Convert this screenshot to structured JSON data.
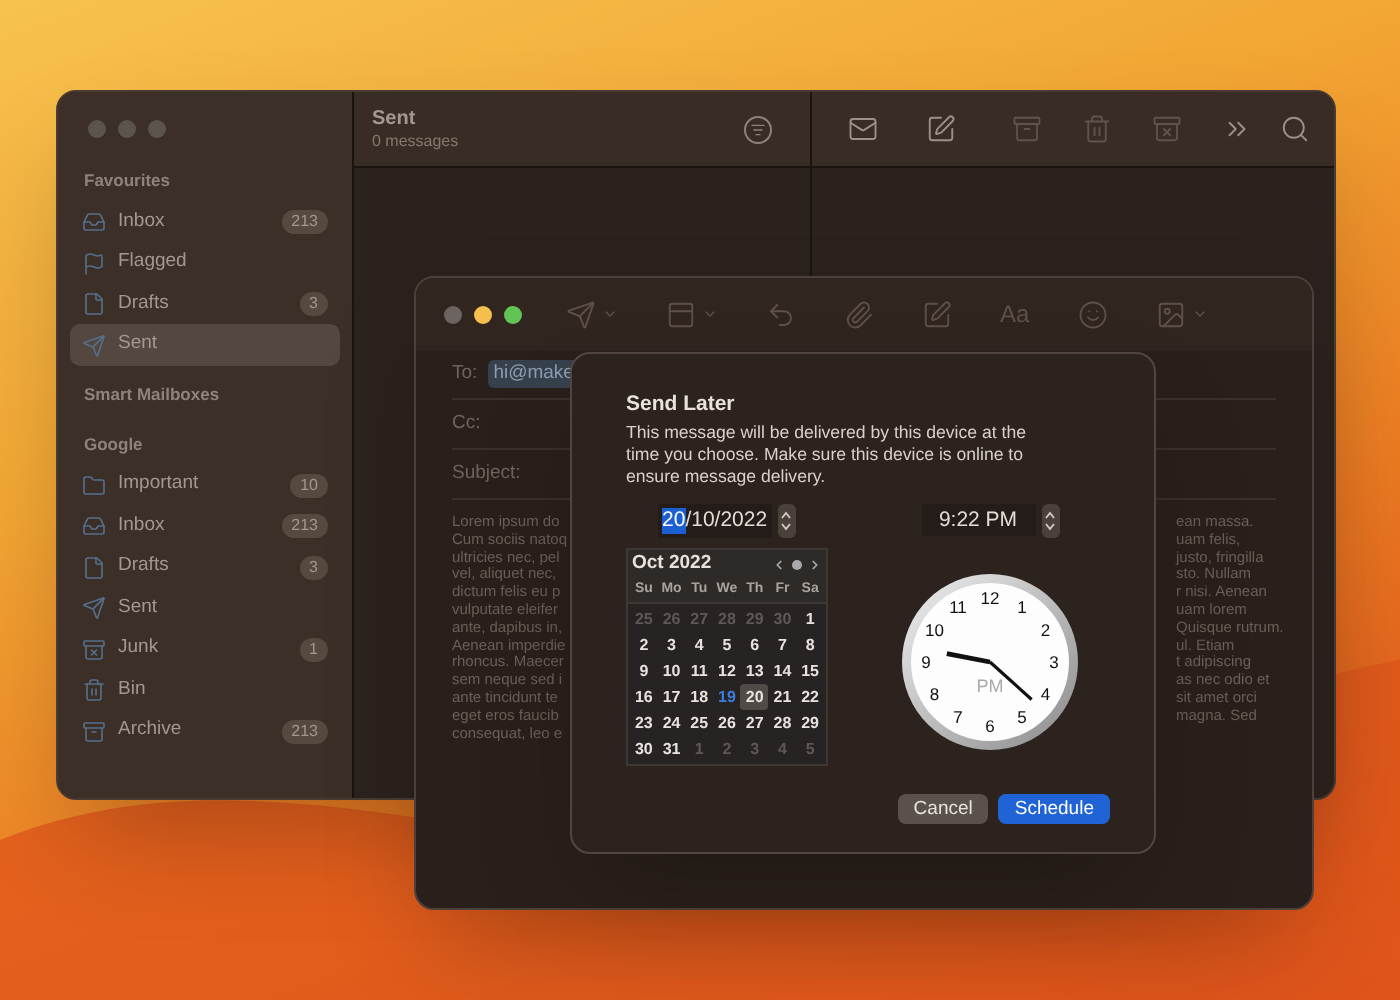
{
  "mail_window": {
    "sidebar": {
      "sections": [
        {
          "title": "Favourites",
          "items": [
            {
              "kind": "inbox",
              "label": "Inbox",
              "count": "213",
              "selected": false
            },
            {
              "kind": "flag",
              "label": "Flagged",
              "selected": false
            },
            {
              "kind": "drafts",
              "label": "Drafts",
              "count": "3",
              "selected": false
            },
            {
              "kind": "sent",
              "label": "Sent",
              "selected": true
            }
          ]
        },
        {
          "title": "Smart Mailboxes"
        },
        {
          "title": "Google",
          "items": [
            {
              "kind": "folder",
              "label": "Important",
              "count": "10",
              "selected": false
            },
            {
              "kind": "inbox",
              "label": "Inbox",
              "count": "213",
              "selected": false
            },
            {
              "kind": "drafts",
              "label": "Drafts",
              "count": "3",
              "selected": false
            },
            {
              "kind": "sent",
              "label": "Sent",
              "selected": false
            },
            {
              "kind": "junk",
              "label": "Junk",
              "count": "1",
              "selected": false
            },
            {
              "kind": "bin",
              "label": "Bin",
              "selected": false
            },
            {
              "kind": "archive",
              "label": "Archive",
              "count": "213",
              "selected": false
            }
          ]
        }
      ]
    },
    "message_list": {
      "title": "Sent",
      "subtitle": "0 messages"
    },
    "toolbar": [
      {
        "kind": "get-mail",
        "disabled": false
      },
      {
        "kind": "compose",
        "disabled": false
      },
      {
        "kind": "archive",
        "disabled": true
      },
      {
        "kind": "trash",
        "disabled": true
      },
      {
        "kind": "junk",
        "disabled": true
      },
      {
        "kind": "more",
        "disabled": false
      },
      {
        "kind": "search",
        "disabled": false
      }
    ]
  },
  "compose_window": {
    "toolbar": [
      {
        "kind": "send",
        "menu": true
      },
      {
        "kind": "header-fields",
        "menu": true
      },
      {
        "kind": "reply",
        "menu": false
      },
      {
        "kind": "attach",
        "menu": false
      },
      {
        "kind": "markup",
        "menu": false
      },
      {
        "kind": "format",
        "label": "Aa",
        "menu": false
      },
      {
        "kind": "emoji",
        "menu": false
      },
      {
        "kind": "photo",
        "menu": true
      }
    ],
    "fields": [
      {
        "label": "To:",
        "chip": "hi@make"
      },
      {
        "label": "Cc:"
      },
      {
        "label": "Subject:"
      }
    ],
    "body_left": [
      "Lorem ipsum do",
      "Cum sociis natoq",
      "ultricies nec, pel",
      "vel, aliquet nec,",
      "dictum felis eu p",
      "vulputate eleifer",
      "ante, dapibus in,",
      "Aenean imperdie",
      "rhoncus. Maecer",
      "sem neque sed i",
      "ante tincidunt te",
      "eget eros faucib",
      "consequat, leo e"
    ],
    "body_right": [
      "ean massa.",
      "uam felis,",
      "justo, fringilla",
      "sto. Nullam",
      "r nisi. Aenean",
      "uam lorem",
      "Quisque rutrum.",
      "ul. Etiam",
      "t adipiscing",
      "as nec odio et",
      "sit amet orci",
      "magna. Sed"
    ]
  },
  "send_later_dialog": {
    "title": "Send Later",
    "description": "This message will be delivered by this device at the time you choose. Make sure this device is online to ensure message delivery.",
    "date_field": [
      {
        "text": "20",
        "selected": true
      },
      {
        "text": "/10/2022",
        "selected": false
      }
    ],
    "time_field": "9:22 PM",
    "calendar": {
      "month": "Oct 2022",
      "weekdays": [
        "Su",
        "Mo",
        "Tu",
        "We",
        "Th",
        "Fr",
        "Sa"
      ],
      "weeks": [
        [
          {
            "day": "25",
            "muted": true,
            "selected": false,
            "today": false
          },
          {
            "day": "26",
            "muted": true,
            "selected": false,
            "today": false
          },
          {
            "day": "27",
            "muted": true,
            "selected": false,
            "today": false
          },
          {
            "day": "28",
            "muted": true,
            "selected": false,
            "today": false
          },
          {
            "day": "29",
            "muted": true,
            "selected": false,
            "today": false
          },
          {
            "day": "30",
            "muted": true,
            "selected": false,
            "today": false
          },
          {
            "day": "1",
            "muted": false,
            "selected": false,
            "today": false
          }
        ],
        [
          {
            "day": "2",
            "muted": false,
            "selected": false,
            "today": false
          },
          {
            "day": "3",
            "muted": false,
            "selected": false,
            "today": false
          },
          {
            "day": "4",
            "muted": false,
            "selected": false,
            "today": false
          },
          {
            "day": "5",
            "muted": false,
            "selected": false,
            "today": false
          },
          {
            "day": "6",
            "muted": false,
            "selected": false,
            "today": false
          },
          {
            "day": "7",
            "muted": false,
            "selected": false,
            "today": false
          },
          {
            "day": "8",
            "muted": false,
            "selected": false,
            "today": false
          }
        ],
        [
          {
            "day": "9",
            "muted": false,
            "selected": false,
            "today": false
          },
          {
            "day": "10",
            "muted": false,
            "selected": false,
            "today": false
          },
          {
            "day": "11",
            "muted": false,
            "selected": false,
            "today": false
          },
          {
            "day": "12",
            "muted": false,
            "selected": false,
            "today": false
          },
          {
            "day": "13",
            "muted": false,
            "selected": false,
            "today": false
          },
          {
            "day": "14",
            "muted": false,
            "selected": false,
            "today": false
          },
          {
            "day": "15",
            "muted": false,
            "selected": false,
            "today": false
          }
        ],
        [
          {
            "day": "16",
            "muted": false,
            "selected": false,
            "today": false
          },
          {
            "day": "17",
            "muted": false,
            "selected": false,
            "today": false
          },
          {
            "day": "18",
            "muted": false,
            "selected": false,
            "today": false
          },
          {
            "day": "19",
            "muted": false,
            "selected": false,
            "today": true
          },
          {
            "day": "20",
            "muted": false,
            "selected": true,
            "today": false
          },
          {
            "day": "21",
            "muted": false,
            "selected": false,
            "today": false
          },
          {
            "day": "22",
            "muted": false,
            "selected": false,
            "today": false
          }
        ],
        [
          {
            "day": "23",
            "muted": false,
            "selected": false,
            "today": false
          },
          {
            "day": "24",
            "muted": false,
            "selected": false,
            "today": false
          },
          {
            "day": "25",
            "muted": false,
            "selected": false,
            "today": false
          },
          {
            "day": "26",
            "muted": false,
            "selected": false,
            "today": false
          },
          {
            "day": "27",
            "muted": false,
            "selected": false,
            "today": false
          },
          {
            "day": "28",
            "muted": false,
            "selected": false,
            "today": false
          },
          {
            "day": "29",
            "muted": false,
            "selected": false,
            "today": false
          }
        ],
        [
          {
            "day": "30",
            "muted": false,
            "selected": false,
            "today": false
          },
          {
            "day": "31",
            "muted": false,
            "selected": false,
            "today": false
          },
          {
            "day": "1",
            "muted": true,
            "selected": false,
            "today": false
          },
          {
            "day": "2",
            "muted": true,
            "selected": false,
            "today": false
          },
          {
            "day": "3",
            "muted": true,
            "selected": false,
            "today": false
          },
          {
            "day": "4",
            "muted": true,
            "selected": false,
            "today": false
          },
          {
            "day": "5",
            "muted": true,
            "selected": false,
            "today": false
          }
        ]
      ]
    },
    "clock": {
      "numerals": [
        "11",
        "12",
        "1",
        "10",
        "2",
        "9",
        "3",
        "8",
        "4",
        "7",
        "6",
        "5"
      ],
      "period": "PM"
    },
    "buttons": [
      {
        "label": "Cancel",
        "kind": "secondary"
      },
      {
        "label": "Schedule",
        "kind": "primary"
      }
    ]
  }
}
